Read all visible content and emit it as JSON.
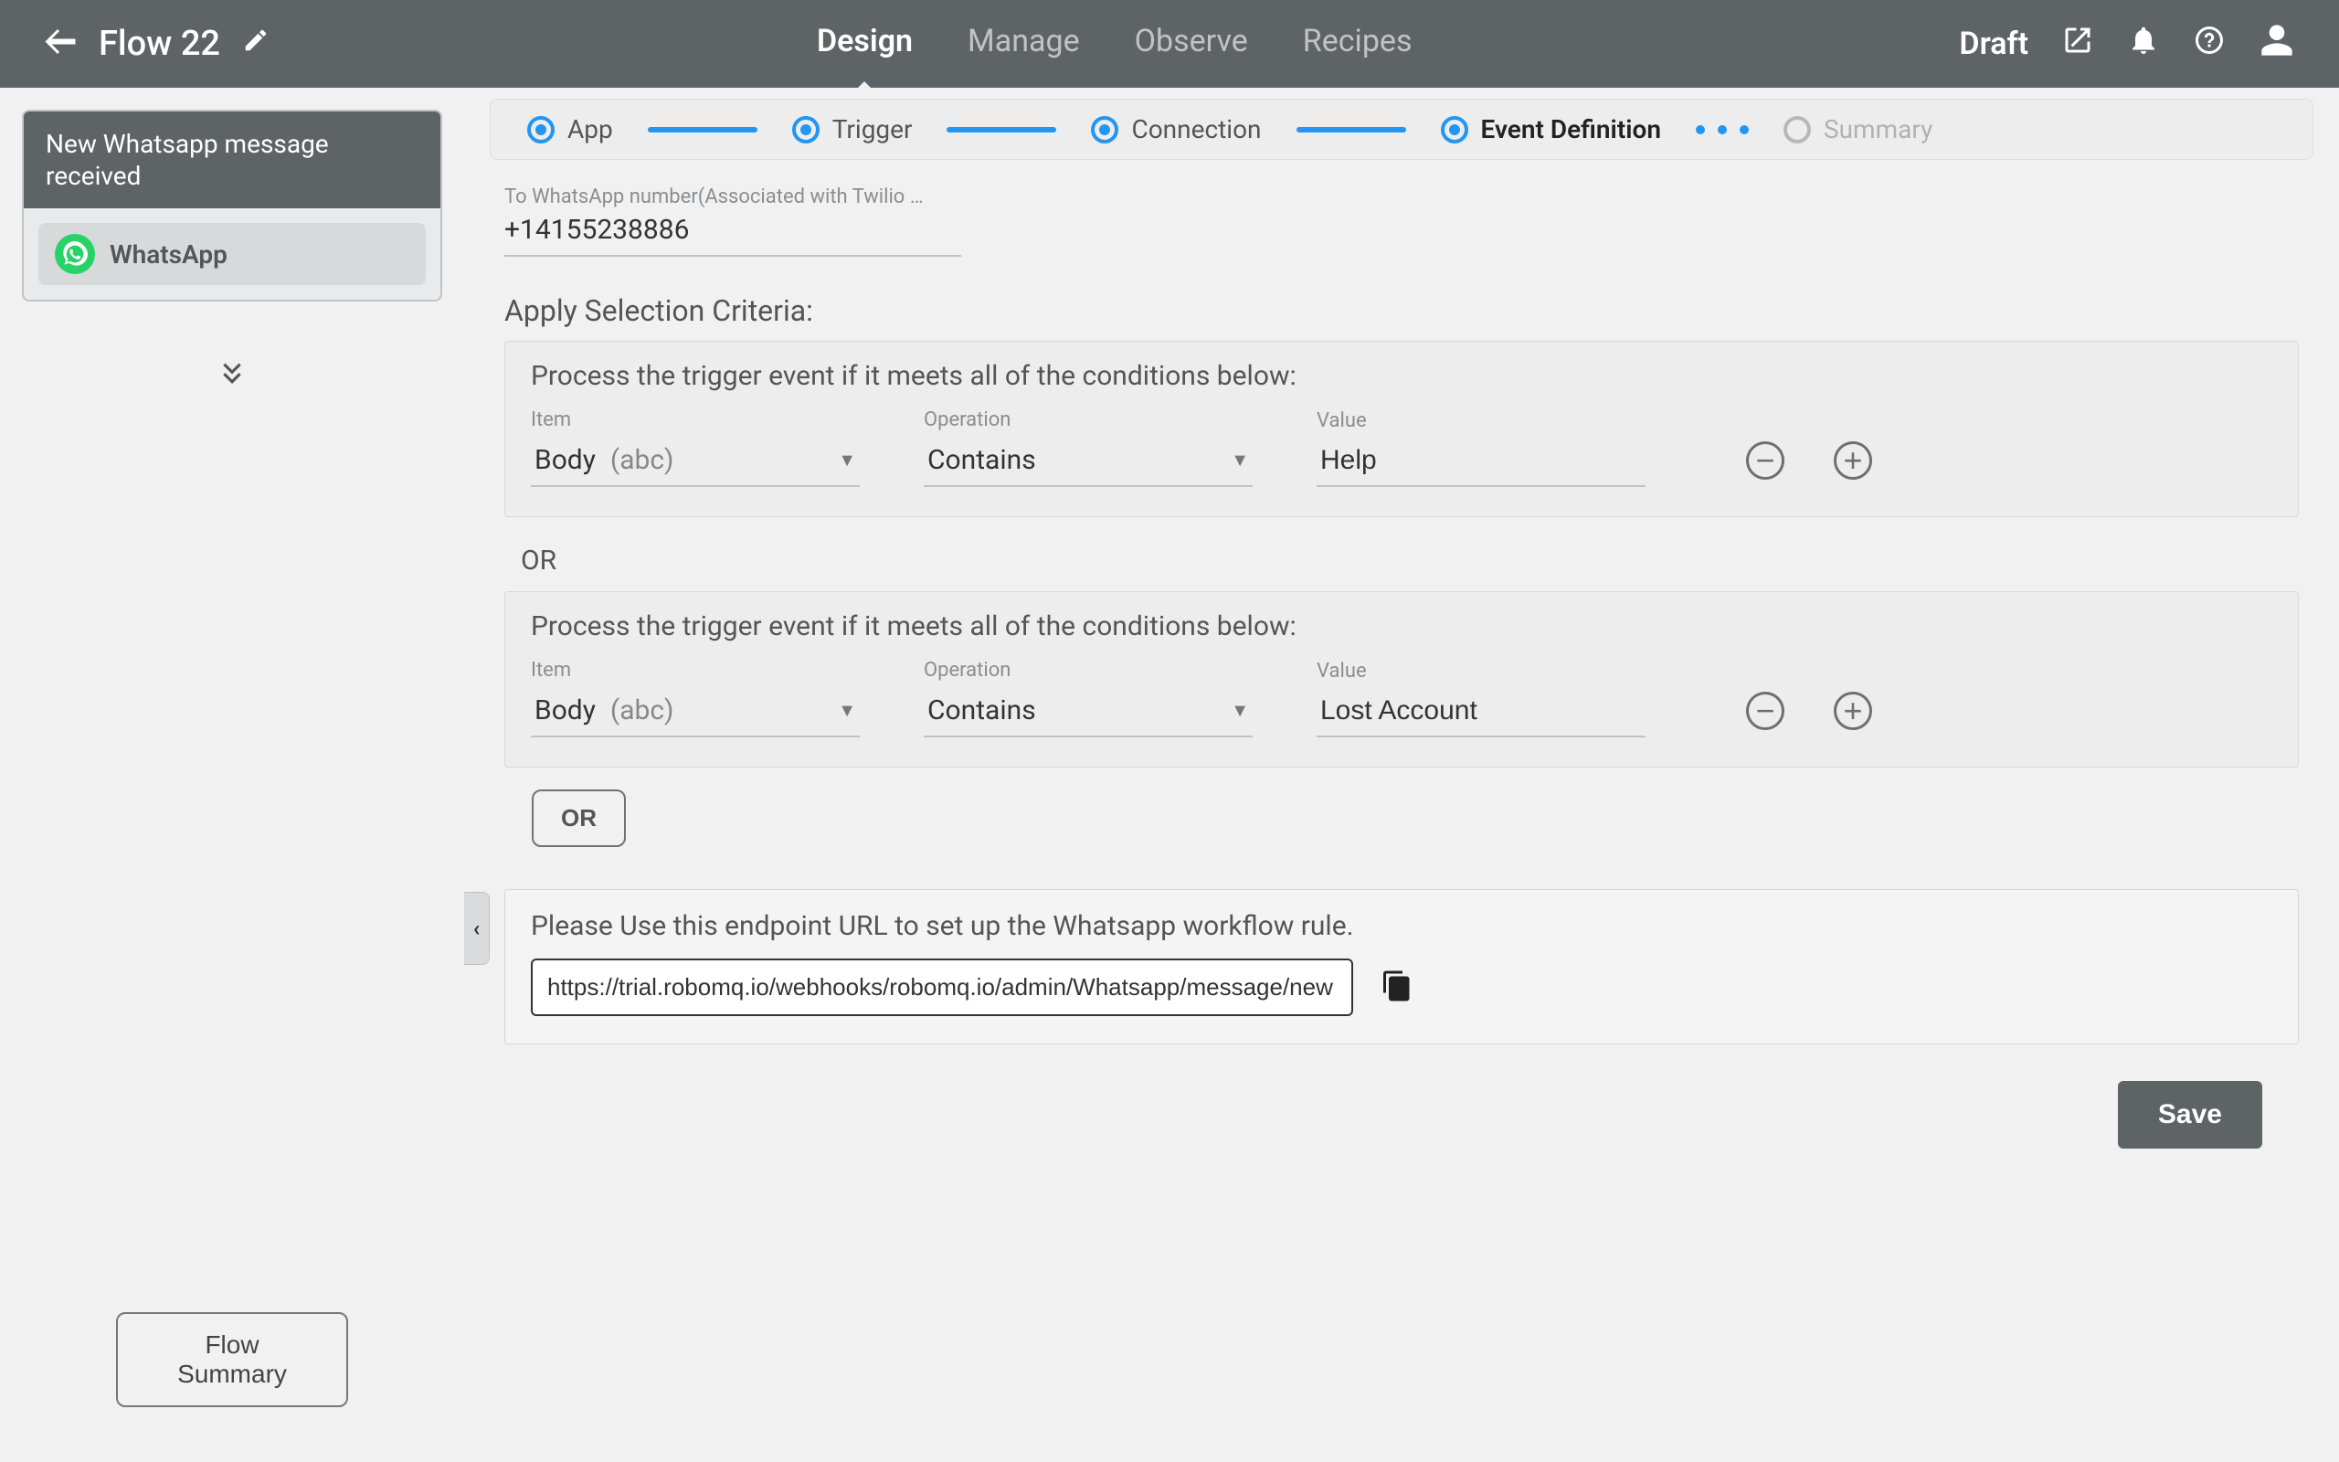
{
  "header": {
    "flow_title": "Flow 22",
    "tabs": [
      "Design",
      "Manage",
      "Observe",
      "Recipes"
    ],
    "active_tab_index": 0,
    "status": "Draft"
  },
  "sidebar": {
    "trigger_card_title": "New Whatsapp message received",
    "app_name": "WhatsApp",
    "flow_summary_button": "Flow Summary"
  },
  "stepper": {
    "steps": [
      "App",
      "Trigger",
      "Connection",
      "Event Definition",
      "Summary"
    ],
    "active_index": 3
  },
  "form": {
    "to_number": {
      "label": "To WhatsApp number(Associated with Twilio accou…",
      "value": "+14155238886"
    },
    "selection_title": "Apply Selection Criteria:",
    "criteria_caption": "Process the trigger event if it meets all of the conditions below:",
    "labels": {
      "item": "Item",
      "operation": "Operation",
      "value": "Value"
    },
    "groups": [
      {
        "item_text": "Body",
        "item_type": "(abc)",
        "operation": "Contains",
        "value": "Help"
      },
      {
        "item_text": "Body",
        "item_type": "(abc)",
        "operation": "Contains",
        "value": "Lost Account"
      }
    ],
    "or_text": "OR",
    "or_button": "OR",
    "endpoint": {
      "caption": "Please Use this endpoint URL to set up the Whatsapp workflow rule.",
      "url": "https://trial.robomq.io/webhooks/robomq.io/admin/Whatsapp/message/new"
    },
    "save_button": "Save"
  }
}
